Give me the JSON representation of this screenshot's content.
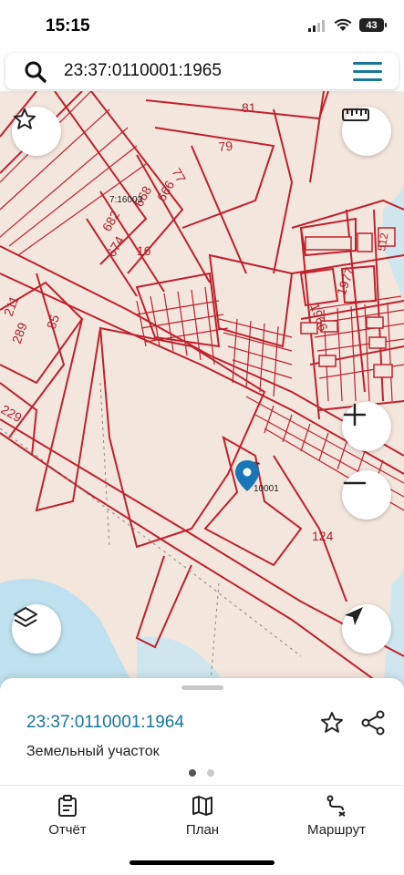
{
  "status": {
    "time": "15:15",
    "battery": "43"
  },
  "search": {
    "query": "23:37:0110001:1965"
  },
  "map": {
    "labels": [
      "81",
      "79",
      "77",
      "666",
      "668",
      "7:16003",
      "682",
      "674",
      "16",
      "211",
      "289",
      "85",
      "229",
      "512",
      "1966",
      "1977",
      "124",
      "10001",
      "54"
    ],
    "colors": {
      "background": "#f3e6dd",
      "line": "#c0212d",
      "water": "#bfe0ee",
      "marker": "#1976b8"
    }
  },
  "parcel": {
    "id": "23:37:0110001:1964",
    "type": "Земельный участок"
  },
  "tabs": [
    {
      "label": "Отчёт",
      "icon": "clipboard-icon"
    },
    {
      "label": "План",
      "icon": "map-icon"
    },
    {
      "label": "Маршрут",
      "icon": "route-icon"
    }
  ],
  "accent": "#17779c"
}
